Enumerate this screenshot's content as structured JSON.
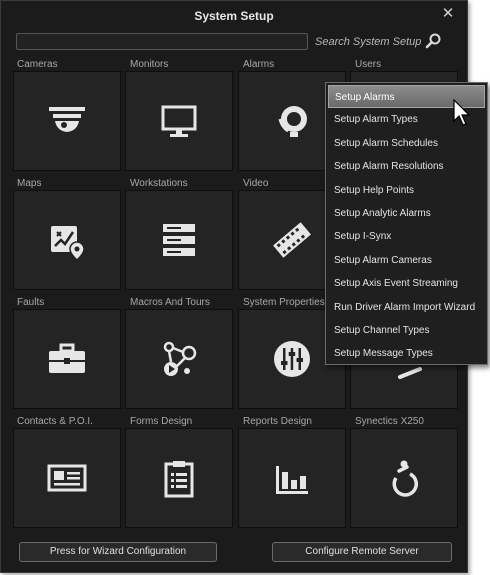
{
  "window": {
    "title": "System Setup"
  },
  "search": {
    "placeholder": "",
    "hint": "Search System Setup"
  },
  "tiles": [
    {
      "label": "Cameras",
      "icon": "camera-icon"
    },
    {
      "label": "Monitors",
      "icon": "monitor-icon"
    },
    {
      "label": "Alarms",
      "icon": "bell-icon"
    },
    {
      "label": "Users",
      "icon": "users-icon"
    },
    {
      "label": "Maps",
      "icon": "map-icon"
    },
    {
      "label": "Workstations",
      "icon": "server-icon"
    },
    {
      "label": "Video",
      "icon": "film-icon"
    },
    {
      "label": "",
      "icon": ""
    },
    {
      "label": "Faults",
      "icon": "toolbox-icon"
    },
    {
      "label": "Macros And Tours",
      "icon": "tour-icon"
    },
    {
      "label": "System Properties",
      "icon": "sliders-icon"
    },
    {
      "label": "",
      "icon": "hidden-icon"
    },
    {
      "label": "Contacts & P.O.I.",
      "icon": "contact-card-icon"
    },
    {
      "label": "Forms Design",
      "icon": "clipboard-icon"
    },
    {
      "label": "Reports Design",
      "icon": "bar-chart-icon"
    },
    {
      "label": "Synectics X250",
      "icon": "x250-icon"
    }
  ],
  "footer": {
    "wizard_button": "Press for Wizard Configuration",
    "remote_button": "Configure Remote Server"
  },
  "dropdown": {
    "items": [
      "Setup Alarms",
      "Setup Alarm Types",
      "Setup Alarm Schedules",
      "Setup Alarm Resolutions",
      "Setup Help Points",
      "Setup Analytic Alarms",
      "Setup I-Synx",
      "Setup Alarm Cameras",
      "Setup Axis Event Streaming",
      "Run Driver Alarm Import Wizard",
      "Setup Channel Types",
      "Setup Message Types"
    ],
    "active_index": 0
  },
  "colors": {
    "background": "#1b1b1b",
    "tile": "#242424",
    "icon": "#e6e6e6",
    "highlight": "#7a7a7a"
  }
}
